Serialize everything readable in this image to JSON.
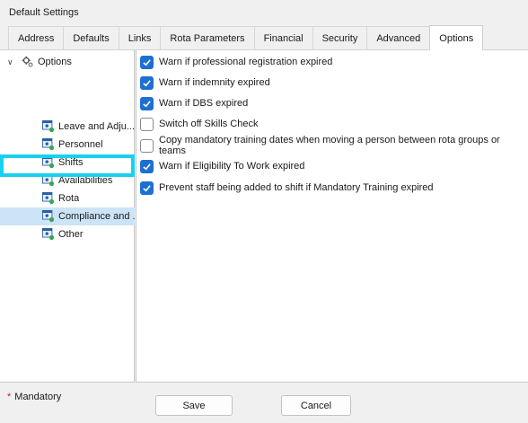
{
  "window": {
    "title": "Default Settings"
  },
  "tabs": [
    {
      "label": "Address",
      "active": false
    },
    {
      "label": "Defaults",
      "active": false
    },
    {
      "label": "Links",
      "active": false
    },
    {
      "label": "Rota Parameters",
      "active": false
    },
    {
      "label": "Financial",
      "active": false
    },
    {
      "label": "Security",
      "active": false
    },
    {
      "label": "Advanced",
      "active": false
    },
    {
      "label": "Options",
      "active": true
    }
  ],
  "tree": {
    "root_label": "Options",
    "root_icon": "gear-icon",
    "items": [
      {
        "label": "Leave and Adju...",
        "icon": "user-settings-icon",
        "selected": false
      },
      {
        "label": "Personnel",
        "icon": "user-settings-icon",
        "selected": false
      },
      {
        "label": "Shifts",
        "icon": "user-settings-icon",
        "selected": false
      },
      {
        "label": "Availabilities",
        "icon": "user-settings-icon",
        "selected": false
      },
      {
        "label": "Rota",
        "icon": "user-settings-icon",
        "selected": false
      },
      {
        "label": "Compliance and ...",
        "icon": "user-settings-icon",
        "selected": true
      },
      {
        "label": "Other",
        "icon": "user-settings-icon",
        "selected": false
      }
    ]
  },
  "options": [
    {
      "label": "Warn if professional registration expired",
      "checked": true
    },
    {
      "label": "Warn if indemnity expired",
      "checked": true
    },
    {
      "label": "Warn if DBS expired",
      "checked": true
    },
    {
      "label": "Switch off Skills Check",
      "checked": false
    },
    {
      "label": "Copy mandatory training dates when moving a person between rota groups or teams",
      "checked": false
    },
    {
      "label": "Warn if Eligibility To Work expired",
      "checked": true
    },
    {
      "label": "Prevent staff being added to shift if Mandatory Training expired",
      "checked": true
    }
  ],
  "footer": {
    "mandatory_star": "*",
    "mandatory_label": "Mandatory",
    "save_label": "Save",
    "cancel_label": "Cancel"
  },
  "colors": {
    "checkbox_checked": "#1e6fd0",
    "selection": "#cce4f7",
    "highlight": "#17d1f0",
    "mandatory_star": "#d21f1f"
  }
}
